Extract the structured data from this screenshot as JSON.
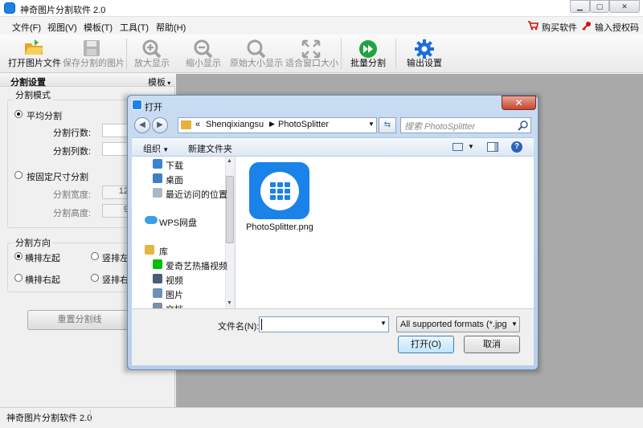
{
  "app": {
    "title": "神奇图片分割软件 2.0",
    "buy": "购买软件",
    "license": "输入授权码"
  },
  "menus": [
    "文件(F)",
    "视图(V)",
    "模板(T)",
    "工具(T)",
    "帮助(H)"
  ],
  "toolbar": {
    "open": "打开图片文件",
    "save": "保存分割的图片",
    "zoom_in": "放大显示",
    "zoom_out": "缩小显示",
    "original": "原始大小显示",
    "fit": "适合窗口大小",
    "batch": "批量分割",
    "output": "输出设置"
  },
  "left_panel": {
    "header": "分割设置",
    "template": "模板",
    "mode_title": "分割模式",
    "even_split": "平均分割",
    "rows_label": "分割行数:",
    "cols_label": "分割列数:",
    "fixed_split": "按固定尺寸分割",
    "width_label": "分割宽度:",
    "width_value": "12",
    "height_label": "分割高度:",
    "height_value": "9",
    "direction_title": "分割方向",
    "h_left": "横排左起",
    "v_left": "竖排左",
    "h_right": "横排右起",
    "v_right": "竖排右",
    "reset": "重置分割线"
  },
  "status": {
    "text": "神奇图片分割软件 2.0"
  },
  "dialog": {
    "title": "打开",
    "path_prefix": "«",
    "path1": "Shenqixiangsu",
    "path2": "PhotoSplitter",
    "search_placeholder": "搜索 PhotoSplitter",
    "organize": "组织",
    "new_folder": "新建文件夹",
    "nav_items": [
      "下载",
      "桌面",
      "最近访问的位置",
      "WPS网盘",
      "库",
      "爱奇艺热播视频",
      "视频",
      "图片",
      "文档"
    ],
    "file_name": "PhotoSplitter.png",
    "filename_label": "文件名(N):",
    "filename_value": "",
    "filter": "All supported formats (*.jpg",
    "open": "打开(O)",
    "cancel": "取消"
  },
  "colors": {
    "accent": "#1a82e8",
    "canvas": "#a9a9a9",
    "close_red": "#c7452d"
  }
}
